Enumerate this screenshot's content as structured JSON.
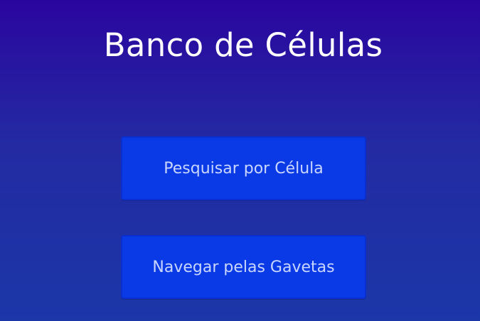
{
  "app": {
    "title": "Banco de Células"
  },
  "menu": {
    "search_label": "Pesquisar por Célula",
    "browse_label": "Navegar pelas Gavetas"
  },
  "colors": {
    "background_top": "#2a069f",
    "background_bottom": "#1b37a8",
    "button_bg": "#0a3ae6",
    "button_text": "#c9d6ff",
    "title_text": "#ffffff"
  }
}
